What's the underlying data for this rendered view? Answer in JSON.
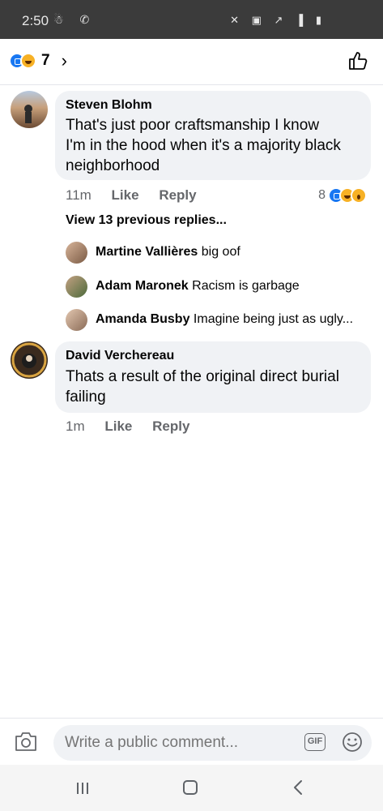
{
  "status_bar": {
    "time": "2:50",
    "left_icons": "☃ ✆",
    "right_icons": "✕ ▣ ↗ ▐ ▮"
  },
  "header": {
    "reaction_count": "7",
    "chevron": "›"
  },
  "comments": [
    {
      "author": "Steven Blohm",
      "lines": [
        "That's just poor craftsmanship I know",
        "I'm in the hood when it's  a majority black",
        "neighborhood"
      ],
      "time": "11m",
      "like_label": "Like",
      "reply_label": "Reply",
      "reactions_count": "8",
      "view_previous": "View 13 previous replies...",
      "replies": [
        {
          "author": "Martine Vallières",
          "text": "big oof"
        },
        {
          "author": "Adam Maronek",
          "text": "Racism is garbage"
        },
        {
          "author": "Amanda Busby",
          "text": "Imagine being just as ugly..."
        }
      ]
    },
    {
      "author": "David Verchereau",
      "lines": [
        "Thats a result of the original direct burial",
        "failing"
      ],
      "time": "1m",
      "like_label": "Like",
      "reply_label": "Reply"
    }
  ],
  "composer": {
    "placeholder": "Write a public comment...",
    "gif_label": "GIF"
  },
  "icons": [
    "like-icon",
    "haha-icon",
    "wow-icon",
    "thumbs-up-icon",
    "camera-icon",
    "gif-icon",
    "emoji-icon",
    "recents-icon",
    "home-icon",
    "back-icon"
  ]
}
